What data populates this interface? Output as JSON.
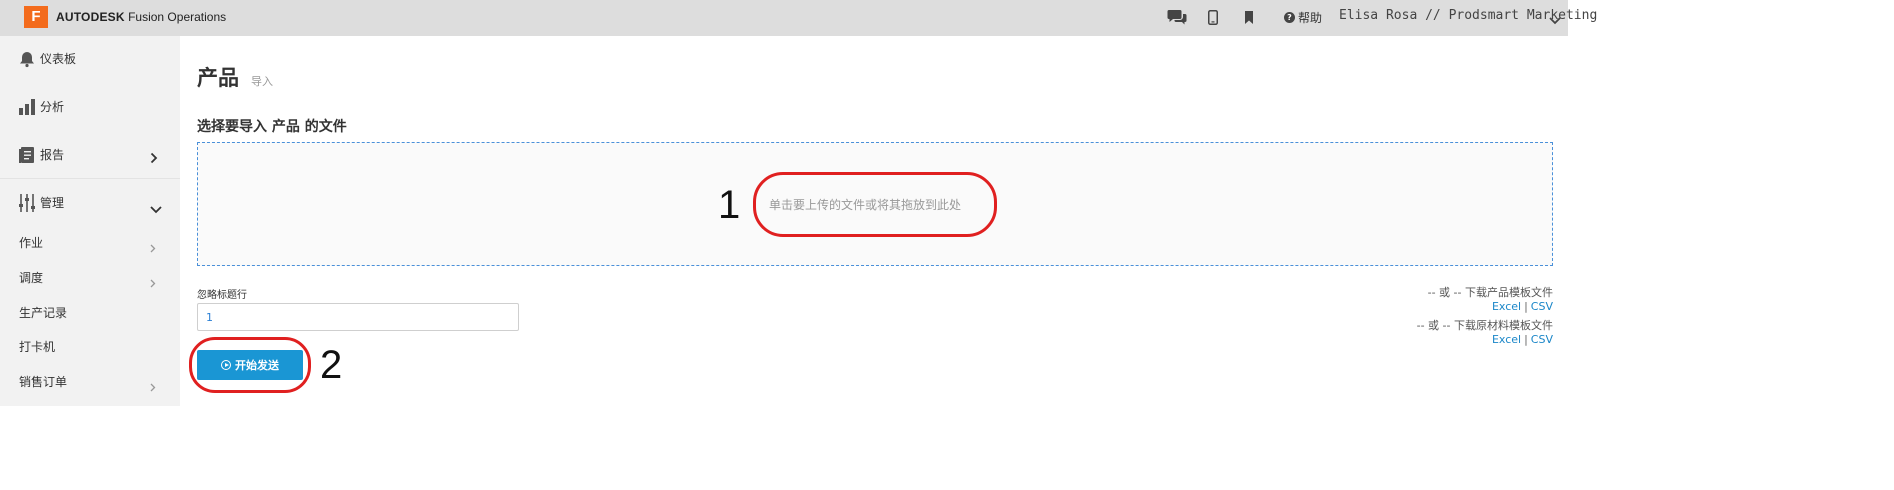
{
  "header": {
    "logo_letter": "F",
    "brand_bold": "AUTODESK",
    "brand_product": "Fusion Operations",
    "help_label": "帮助",
    "user": "Elisa Rosa // Prodsmart Marketing",
    "icons": [
      "chat-icon",
      "mobile-icon",
      "bookmark-icon",
      "help-icon",
      "chevron-down-icon"
    ]
  },
  "sidebar": {
    "main_items": [
      {
        "label": "仪表板",
        "icon": "bell-icon"
      },
      {
        "label": "分析",
        "icon": "bar-chart-icon"
      },
      {
        "label": "报告",
        "icon": "document-icon"
      },
      {
        "label": "管理",
        "icon": "sliders-icon"
      }
    ],
    "sub_items": [
      {
        "label": "作业"
      },
      {
        "label": "调度"
      },
      {
        "label": "生产记录"
      },
      {
        "label": "打卡机"
      },
      {
        "label": "销售订单"
      }
    ]
  },
  "main": {
    "title": "产品",
    "subtitle": "导入",
    "section_title": "选择要导入 产品 的文件",
    "dropzone_text": "单击要上传的文件或将其拖放到此处",
    "skip_header_label": "忽略标题行",
    "skip_header_value": "1",
    "start_button": "开始发送",
    "product_template_text": "-- 或 -- 下载产品模板文件",
    "material_template_text": "-- 或 -- 下载原材料模板文件",
    "link_excel": "Excel",
    "link_separator": "|",
    "link_csv": "CSV"
  },
  "annotations": {
    "step1": "1",
    "step2": "2",
    "highlight_color": "#e02020"
  },
  "colors": {
    "primary": "#1a96d4",
    "logo": "#f36b1c",
    "link": "#1a86c8"
  }
}
